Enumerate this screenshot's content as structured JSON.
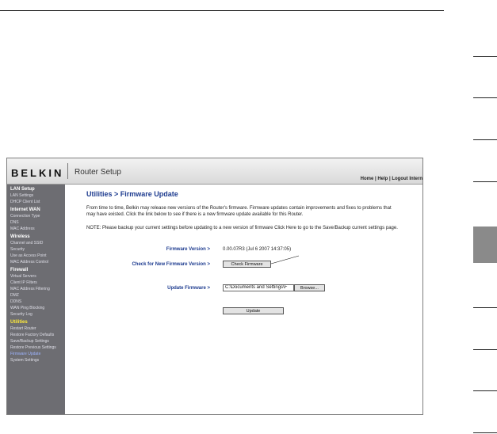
{
  "header": {
    "brand": "BELKIN",
    "product": "Router Setup",
    "links_text": "Home | Help | Logout   Intern"
  },
  "sidebar": [
    {
      "label": "LAN Setup",
      "type": "section"
    },
    {
      "label": "LAN Settings",
      "type": "item"
    },
    {
      "label": "DHCP Client List",
      "type": "item"
    },
    {
      "label": "Internet WAN",
      "type": "section"
    },
    {
      "label": "Connection Type",
      "type": "item"
    },
    {
      "label": "DNS",
      "type": "item"
    },
    {
      "label": "MAC Address",
      "type": "item"
    },
    {
      "label": "Wireless",
      "type": "section"
    },
    {
      "label": "Channel and SSID",
      "type": "item"
    },
    {
      "label": "Security",
      "type": "item"
    },
    {
      "label": "Use as Access Point",
      "type": "item"
    },
    {
      "label": "MAC Address Control",
      "type": "item"
    },
    {
      "label": "Firewall",
      "type": "section"
    },
    {
      "label": "Virtual Servers",
      "type": "item"
    },
    {
      "label": "Client IP Filters",
      "type": "item"
    },
    {
      "label": "MAC Address Filtering",
      "type": "item"
    },
    {
      "label": "DMZ",
      "type": "item"
    },
    {
      "label": "DDNS",
      "type": "item"
    },
    {
      "label": "WAN Ping Blocking",
      "type": "item"
    },
    {
      "label": "Security Log",
      "type": "item"
    },
    {
      "label": "Utilities",
      "type": "section-active"
    },
    {
      "label": "Restart Router",
      "type": "item"
    },
    {
      "label": "Restore Factory Defaults",
      "type": "item"
    },
    {
      "label": "Save/Backup Settings",
      "type": "item"
    },
    {
      "label": "Restore Previous Settings",
      "type": "item"
    },
    {
      "label": "Firmware Update",
      "type": "item-current"
    },
    {
      "label": "System Settings",
      "type": "item"
    }
  ],
  "main": {
    "title": "Utilities > Firmware Update",
    "intro": "From time to time, Belkin may release new versions of the Router's firmware. Firmware updates contain improvements and fixes to problems that may have existed. Click the link below to see if there is a new firmware update available for this Router.",
    "note": "NOTE: Please backup your current settings before updating to a new version of firmware Click Here to go to the Save/Backup current settings page.",
    "firmware_label": "Firmware Version >",
    "firmware_value": "0.00.07R3 (Jul 6 2007 14:37:05)",
    "check_label": "Check for New Firmware Version >",
    "check_button": "Check Firmware",
    "update_label": "Update Firmware >",
    "file_value": "C:\\Documents and Settings\\F",
    "browse_button": "Browse...",
    "update_button": "Update"
  }
}
